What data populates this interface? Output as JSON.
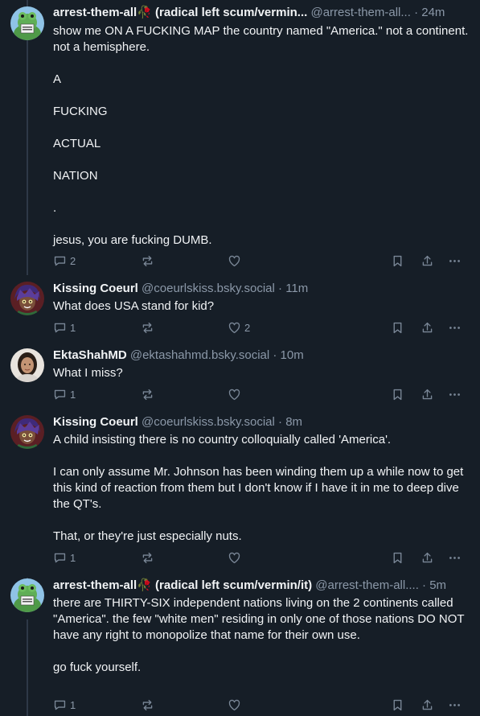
{
  "posts": [
    {
      "name": "arrest-them-all🥀 (radical left scum/vermin...",
      "handle": "@arrest-them-all...",
      "time": "· 24m",
      "text": "show me ON A FUCKING MAP the country named \"America.\" not a continent. not a hemisphere.\n\nA\n\nFUCKING\n\nACTUAL\n\nNATION\n\n.\n\njesus, you are fucking DUMB.",
      "reply_count": "2",
      "like_count": ""
    },
    {
      "name": "Kissing Coeurl",
      "handle": "@coeurlskiss.bsky.social",
      "time": "· 11m",
      "text": "What does USA stand for kid?",
      "reply_count": "1",
      "like_count": "2"
    },
    {
      "name": "EktaShahMD",
      "handle": "@ektashahmd.bsky.social",
      "time": "· 10m",
      "text": "What I miss?",
      "reply_count": "1",
      "like_count": ""
    },
    {
      "name": "Kissing Coeurl",
      "handle": "@coeurlskiss.bsky.social",
      "time": "· 8m",
      "text": "A child insisting there is no country colloquially called 'America'.\n\nI can only assume Mr. Johnson has been winding them up a while now to get this kind of reaction from them but I don't know if I have it in me to deep dive the QT's.\n\nThat, or they're just especially nuts.",
      "reply_count": "1",
      "like_count": ""
    },
    {
      "name": "arrest-them-all🥀 (radical left scum/vermin/it)",
      "handle": "@arrest-them-all....",
      "time": "· 5m",
      "text": "there are THIRTY-SIX independent nations living on the 2 continents called \"America\". the few \"white men\" residing in only one of those nations DO NOT have any right to monopolize that name for their own use.\n\ngo fuck yourself.",
      "reply_count": "1",
      "like_count": ""
    }
  ]
}
